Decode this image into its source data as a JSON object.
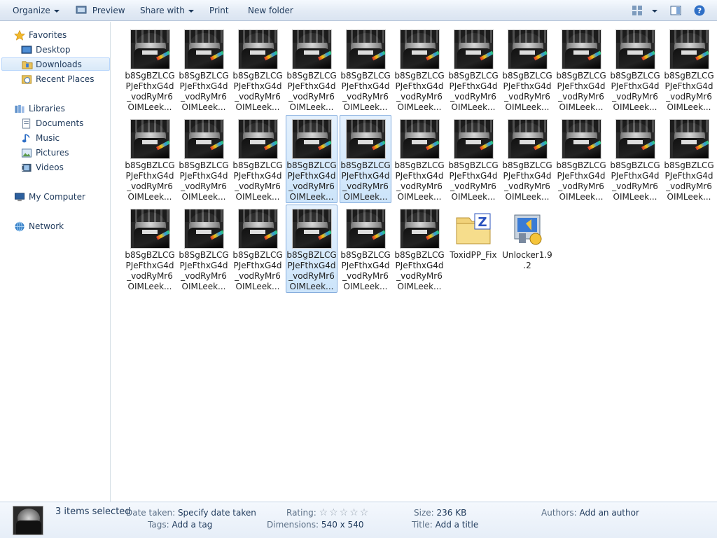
{
  "toolbar": {
    "organize": "Organize",
    "preview": "Preview",
    "share_with": "Share with",
    "print": "Print",
    "new_folder": "New folder"
  },
  "nav": {
    "favorites": "Favorites",
    "desktop": "Desktop",
    "downloads": "Downloads",
    "recent_places": "Recent Places",
    "libraries": "Libraries",
    "documents": "Documents",
    "music": "Music",
    "pictures": "Pictures",
    "videos": "Videos",
    "my_computer": "My Computer",
    "network": "Network"
  },
  "files": {
    "image_name": "b8SgBZLCGPJeFthxG4d_vodRyMr6OIMLeek...",
    "image_line1": "b8SgBZLCG",
    "image_line2": "PJeFthxG4d",
    "image_line3": "_vodRyMr6",
    "image_line4": "OIMLeek...",
    "zip_name": "ToxidPP_Fix",
    "unlocker_line1": "Unlocker1.9",
    "unlocker_line2": ".2"
  },
  "details": {
    "selection": "3 items selected",
    "date_taken_key": "Date taken:",
    "date_taken_val": "Specify date taken",
    "tags_key": "Tags:",
    "tags_val": "Add a tag",
    "rating_key": "Rating:",
    "rating_stars": "☆☆☆☆☆",
    "dimensions_key": "Dimensions:",
    "dimensions_val": "540 x 540",
    "size_key": "Size:",
    "size_val": "236 KB",
    "title_key": "Title:",
    "title_val": "Add a title",
    "authors_key": "Authors:",
    "authors_val": "Add an author"
  },
  "colors": {
    "toolbar_bg": "#dae4f1",
    "selection_bg": "#cce4fa",
    "selection_border": "#84acdd",
    "text": "#1e395b"
  },
  "icons": [
    "star-icon",
    "desktop-icon",
    "folder-icon",
    "recent-places-icon",
    "libraries-icon",
    "documents-icon",
    "music-icon",
    "pictures-icon",
    "videos-icon",
    "computer-icon",
    "network-icon",
    "preview-icon",
    "view-options-icon",
    "preview-pane-icon",
    "help-icon",
    "zip-folder-icon",
    "installer-icon"
  ]
}
